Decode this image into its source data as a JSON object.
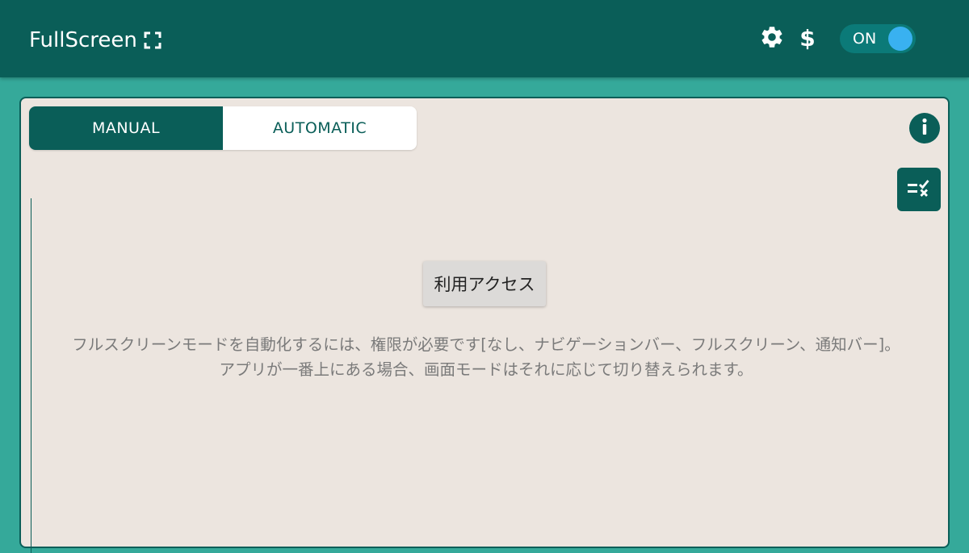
{
  "appbar": {
    "title": "FullScreen",
    "title_icon": "fullscreen-icon",
    "settings_icon": "gear-icon",
    "donate_label": "$",
    "switch_label": "ON",
    "switch_on": true
  },
  "tabs": [
    {
      "label": "MANUAL",
      "selected": true
    },
    {
      "label": "AUTOMATIC",
      "selected": false
    }
  ],
  "icons": {
    "info": "info-icon",
    "checklist": "checklist-icon"
  },
  "main": {
    "access_button_label": "利用アクセス",
    "description": "フルスクリーンモードを自動化するには、権限が必要です[なし、ナビゲーションバー、フルスクリーン、通知バー]。\nアプリが一番上にある場合、画面モードはそれに応じて切り替えられます。"
  },
  "colors": {
    "primary": "#0a5e58",
    "background": "#35a99a",
    "card": "#ece5df",
    "switch_knob": "#39b1f0"
  }
}
